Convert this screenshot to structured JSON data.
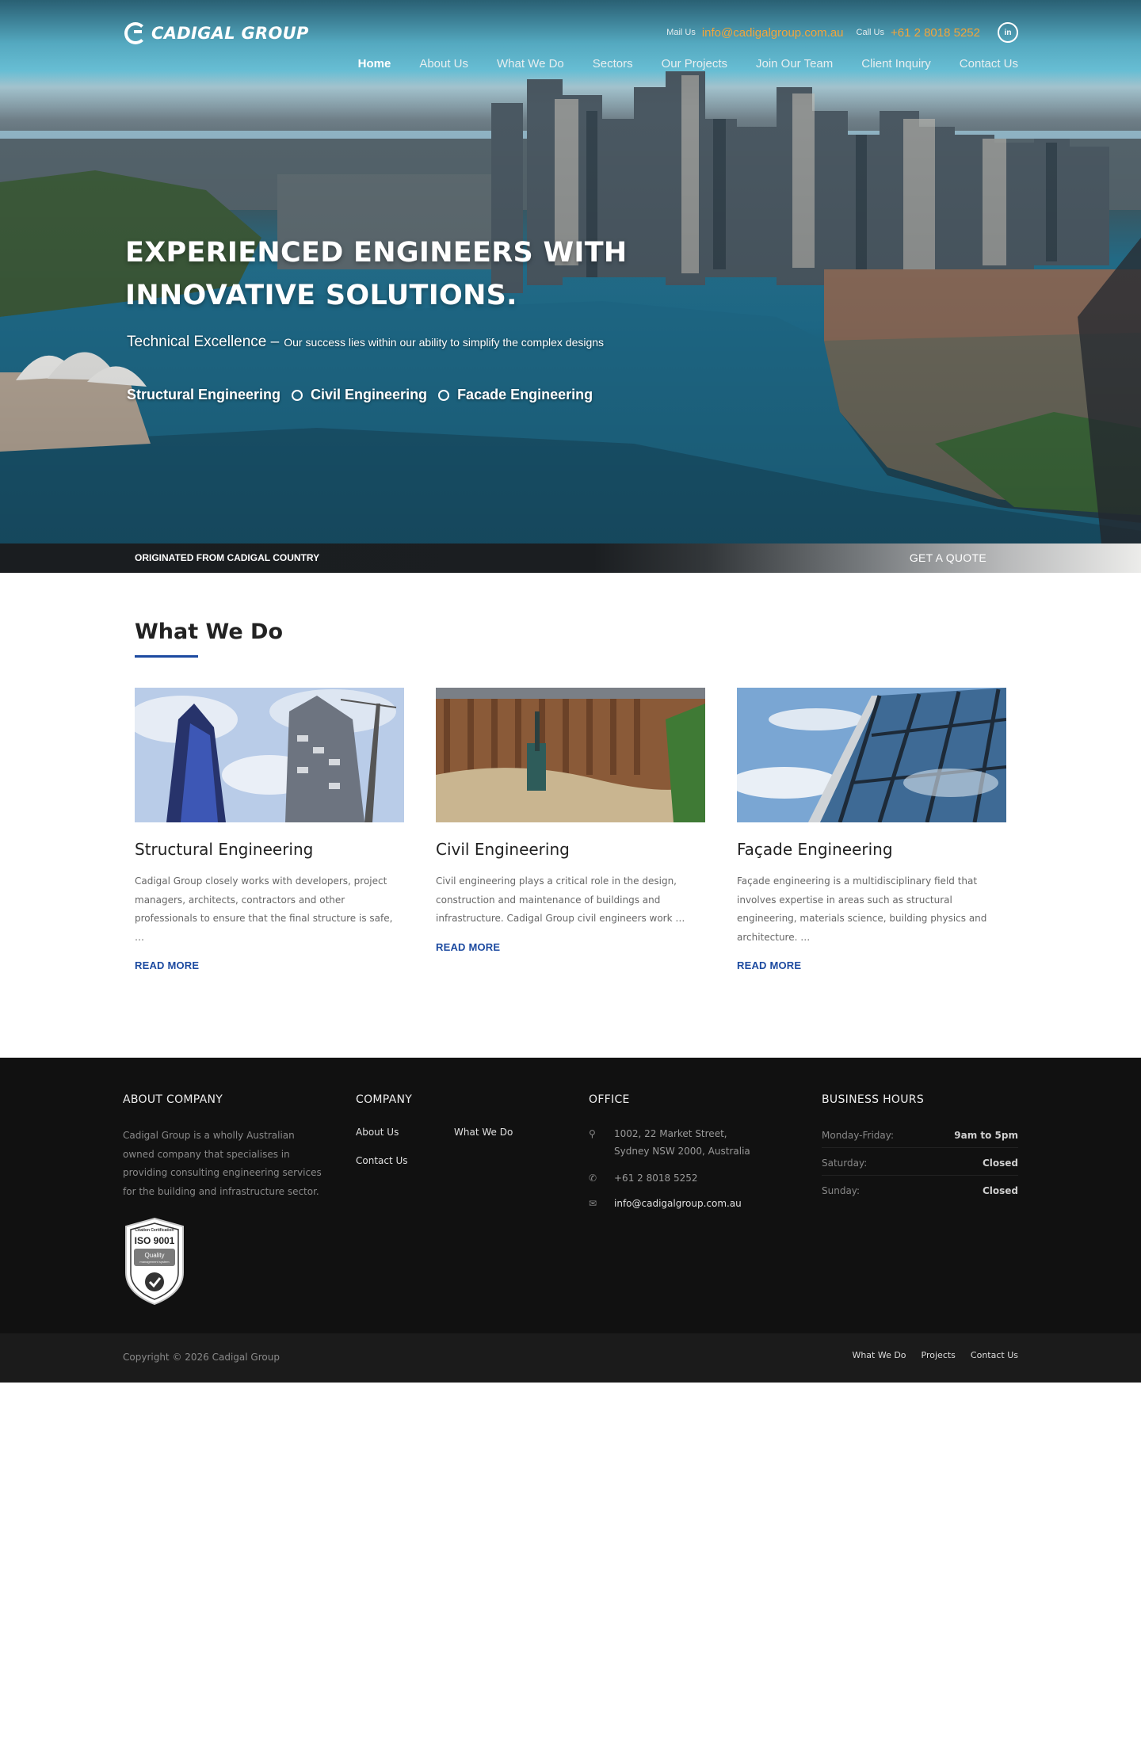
{
  "header": {
    "logo_text": "CADIGAL GROUP",
    "mail_label": "Mail Us",
    "mail_value": "info@cadigalgroup.com.au",
    "call_label": "Call Us",
    "call_value": "+61 2 8018 5252",
    "nav": [
      {
        "label": "Home",
        "active": true
      },
      {
        "label": "About Us"
      },
      {
        "label": "What We Do"
      },
      {
        "label": "Sectors"
      },
      {
        "label": "Our Projects"
      },
      {
        "label": "Join Our Team"
      },
      {
        "label": "Client Inquiry"
      },
      {
        "label": "Contact Us"
      }
    ]
  },
  "hero": {
    "title_line1": "EXPERIENCED ENGINEERS WITH",
    "title_line2": "INNOVATIVE SOLUTIONS.",
    "sub_main": "Technical Excellence –",
    "sub_small": "Our success lies within our ability to simplify the complex designs",
    "services": [
      "Structural Engineering",
      "Civil Engineering",
      "Facade Engineering"
    ]
  },
  "strip": {
    "left": "ORIGINATED FROM CADIGAL COUNTRY",
    "right": "GET A QUOTE"
  },
  "what_we_do": {
    "title": "What We Do",
    "cards": [
      {
        "title": "Structural Engineering",
        "text": "Cadigal Group closely works with developers, project managers, architects, contractors and other professionals to ensure that the final structure is safe, …",
        "link": "READ MORE"
      },
      {
        "title": "Civil Engineering",
        "text": "Civil engineering plays a critical role in the design, construction and maintenance of buildings and infrastructure. Cadigal Group civil engineers work …",
        "link": "READ MORE"
      },
      {
        "title": "Façade Engineering",
        "text": "Façade engineering is a multidisciplinary field that involves expertise in areas such as structural engineering, materials science, building physics and architecture. …",
        "link": "READ MORE"
      }
    ]
  },
  "footer": {
    "about": {
      "title": "ABOUT COMPANY",
      "text": "Cadigal Group is a wholly Australian owned company that specialises in providing consulting engineering services for the building and infrastructure sector.",
      "badge_top": "Citation Certification",
      "badge_main": "ISO 9001",
      "badge_label": "Quality",
      "badge_sub": "management system"
    },
    "company": {
      "title": "COMPANY",
      "links": [
        "About Us",
        "What We Do",
        "Contact Us"
      ]
    },
    "office": {
      "title": "OFFICE",
      "address_line1": "1002, 22 Market Street,",
      "address_line2": "Sydney NSW 2000, Australia",
      "phone": "+61 2 8018 5252",
      "email": "info@cadigalgroup.com.au"
    },
    "hours": {
      "title": "BUSINESS HOURS",
      "rows": [
        {
          "day": "Monday-Friday:",
          "time": "9am to 5pm"
        },
        {
          "day": "Saturday:",
          "time": "Closed"
        },
        {
          "day": "Sunday:",
          "time": "Closed"
        }
      ]
    }
  },
  "bottom": {
    "copyright": "Copyright © 2026 Cadigal Group",
    "links": [
      "What We Do",
      "Projects",
      "Contact Us"
    ]
  }
}
